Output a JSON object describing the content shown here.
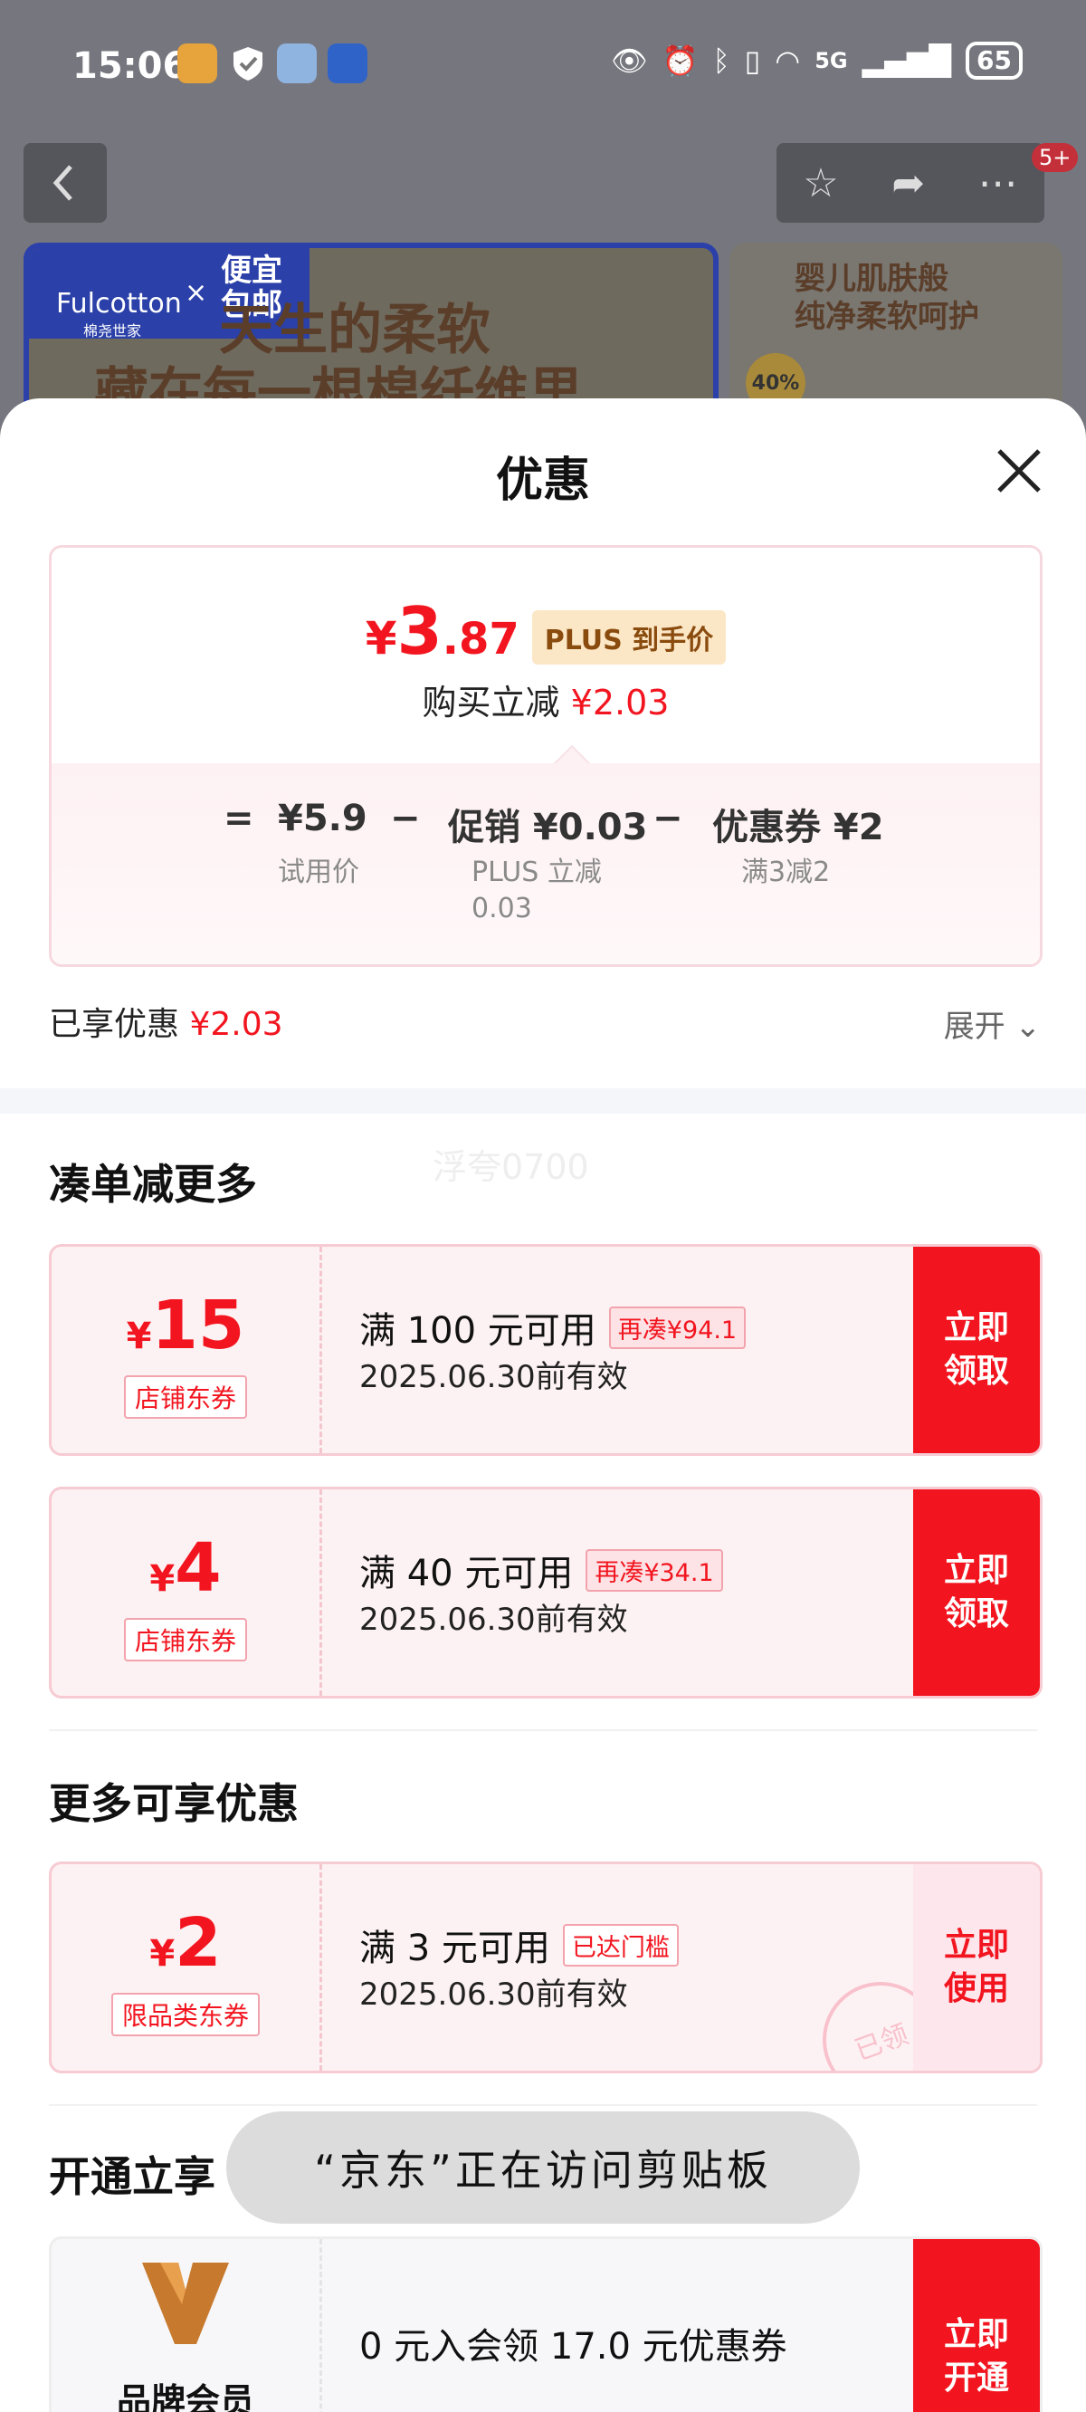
{
  "status_bar": {
    "time": "15:06",
    "network": "5G",
    "battery": "65"
  },
  "background": {
    "nav_badge": "5+",
    "banner_left_brand": "Fulcotton",
    "banner_left_brand_sub": "棉尧世家",
    "banner_left_x": "×",
    "banner_left_tag": "便宜包邮",
    "banner_left_line1": "天生的柔软",
    "banner_left_line2": "藏在每一根棉纤维里",
    "banner_right_line1": "婴儿肌肤般",
    "banner_right_line2": "纯净柔软呵护",
    "banner_right_badge": "40%"
  },
  "sheet": {
    "title": "优惠",
    "price": {
      "yen": "¥",
      "integer": "3",
      "decimal": ".87",
      "tag": "PLUS 到手价"
    },
    "save_label": "购买立减",
    "save_amount": "¥2.03",
    "formula": {
      "eq": "=",
      "base": "¥5.9",
      "minus1": "−",
      "promo": "促销 ¥0.03",
      "minus2": "−",
      "coupon": "优惠券 ¥2",
      "base_label": "试用价",
      "promo_label_1": "PLUS 立减",
      "promo_label_2": "0.03",
      "coupon_label": "满3减2"
    },
    "enjoyed_label": "已享优惠",
    "enjoyed_amount": "¥2.03",
    "expand_label": "展开",
    "watermark": "浮夸0700"
  },
  "section_more": {
    "title": "凑单减更多",
    "coupons": [
      {
        "yen": "¥",
        "amount": "15",
        "type": "店铺东券",
        "condition": "满 100 元可用",
        "tag": "再凑¥94.1",
        "date": "2025.06.30前有效",
        "btn1": "立即",
        "btn2": "领取"
      },
      {
        "yen": "¥",
        "amount": "4",
        "type": "店铺东券",
        "condition": "满 40 元可用",
        "tag": "再凑¥34.1",
        "date": "2025.06.30前有效",
        "btn1": "立即",
        "btn2": "领取"
      }
    ]
  },
  "section_enjoy": {
    "title": "更多可享优惠",
    "coupon": {
      "yen": "¥",
      "amount": "2",
      "type": "限品类东券",
      "condition": "满 3 元可用",
      "tag": "已达门槛",
      "date": "2025.06.30前有效",
      "btn1": "立即",
      "btn2": "使用",
      "stamp": "已领"
    }
  },
  "section_open": {
    "title": "开通立享",
    "member_label": "品牌会员",
    "offer": "0 元入会领 17.0 元优惠券",
    "btn1": "立即",
    "btn2": "开通"
  },
  "toast": "“京东”正在访问剪贴板"
}
